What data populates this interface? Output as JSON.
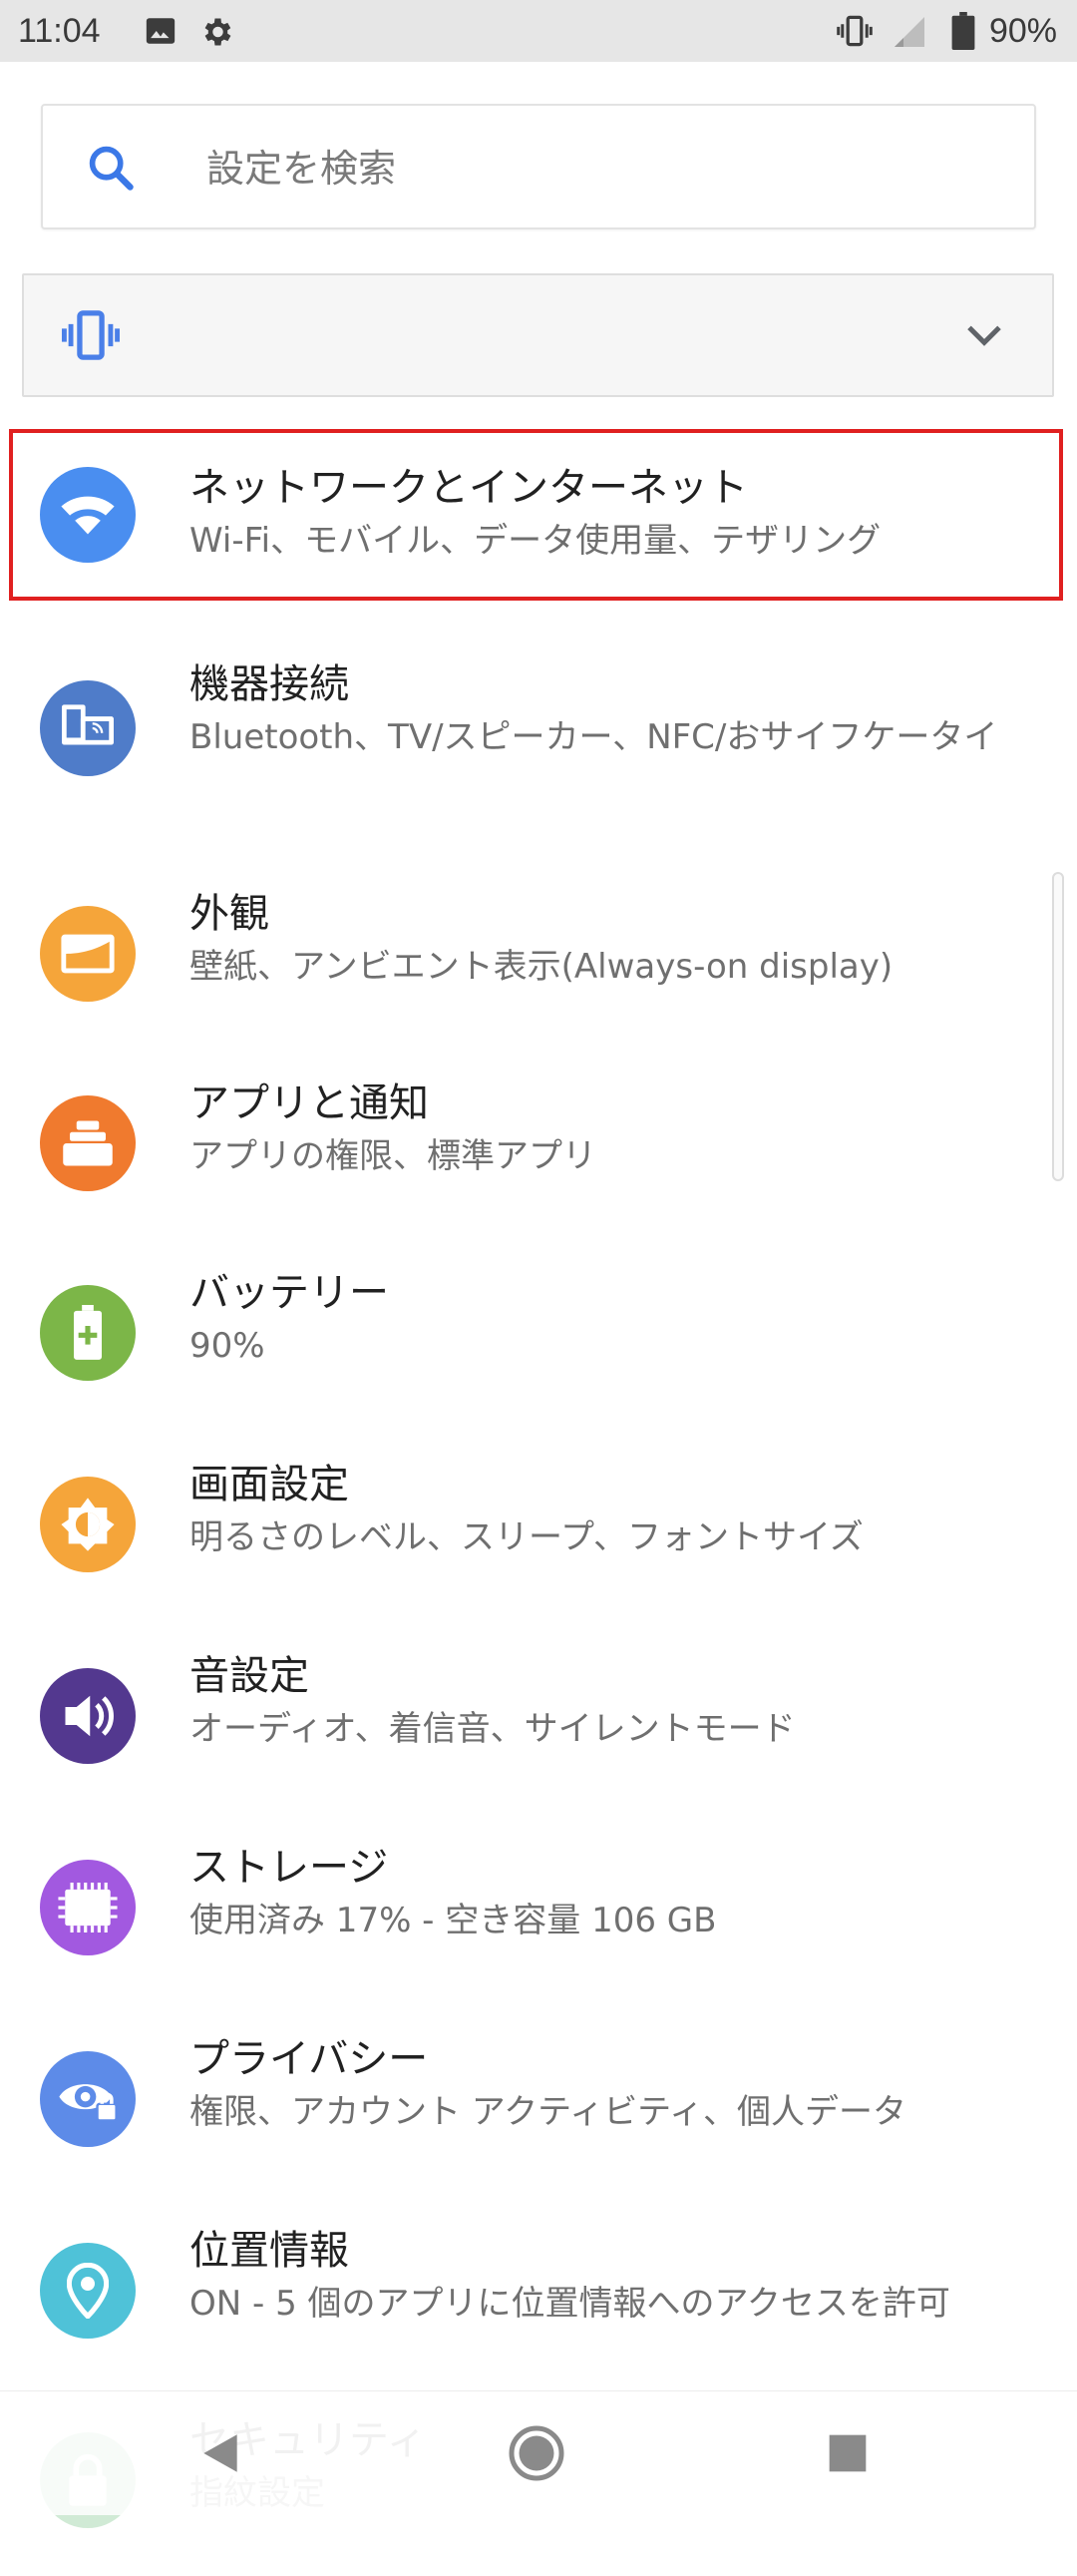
{
  "status_bar": {
    "time": "11:04",
    "left_icons": [
      "image-icon",
      "gear-icon"
    ],
    "right_icons": [
      "vibrate-icon",
      "signal-icon",
      "battery-icon"
    ],
    "battery_percent": "90%"
  },
  "search": {
    "placeholder": "設定を検索"
  },
  "sound_condition": {
    "icon": "vibrate-icon",
    "expand_icon": "chevron-down-icon"
  },
  "items": [
    {
      "title": "ネットワークとインターネット",
      "subtitle": "Wi-Fi、モバイル、データ使用量、テザリング",
      "icon": "wifi-icon",
      "color": "#4a8ef0",
      "highlighted": true
    },
    {
      "title": "機器接続",
      "subtitle": "Bluetooth、TV/スピーカー、NFC/おサイフケータイ",
      "icon": "devices-icon",
      "color": "#4f7cc9"
    },
    {
      "title": "外観",
      "subtitle": "壁紙、アンビエント表示(Always-on display)",
      "icon": "wallpaper-icon",
      "color": "#f5a53a"
    },
    {
      "title": "アプリと通知",
      "subtitle": "アプリの権限、標準アプリ",
      "icon": "apps-icon",
      "color": "#f07a2e"
    },
    {
      "title": "バッテリー",
      "subtitle": "90%",
      "icon": "battery-icon",
      "color": "#7cb648"
    },
    {
      "title": "画面設定",
      "subtitle": "明るさのレベル、スリープ、フォントサイズ",
      "icon": "brightness-icon",
      "color": "#f5a53a"
    },
    {
      "title": "音設定",
      "subtitle": "オーディオ、着信音、サイレントモード",
      "icon": "volume-icon",
      "color": "#53388f"
    },
    {
      "title": "ストレージ",
      "subtitle": "使用済み 17% - 空き容量 106 GB",
      "icon": "storage-icon",
      "color": "#a259e0"
    },
    {
      "title": "プライバシー",
      "subtitle": "権限、アカウント アクティビティ、個人データ",
      "icon": "privacy-icon",
      "color": "#5d8be8"
    },
    {
      "title": "位置情報",
      "subtitle": "ON - 5 個のアプリに位置情報へのアクセスを許可",
      "icon": "location-icon",
      "color": "#4fc2d8"
    },
    {
      "title": "セキュリティ",
      "subtitle": "指紋設定",
      "icon": "lock-icon",
      "color": "#7cc68a"
    }
  ],
  "nav_bar": {
    "icons": [
      "back-icon",
      "home-icon",
      "recents-icon"
    ]
  }
}
